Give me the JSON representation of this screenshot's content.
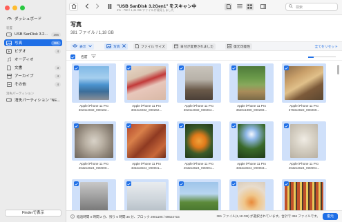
{
  "sidebar": {
    "items": [
      {
        "label": "ダッシュボード",
        "icon": "dashboard-icon"
      },
      {
        "label": "USB  SanDisk 3.2...",
        "count": "396",
        "icon": "drive-icon"
      },
      {
        "label": "写真",
        "count": "381",
        "icon": "photo-icon"
      },
      {
        "label": "ビデオ",
        "count": "4",
        "icon": "video-icon"
      },
      {
        "label": "オーディオ",
        "icon": "audio-icon"
      },
      {
        "label": "文書",
        "count": "3",
        "icon": "document-icon"
      },
      {
        "label": "アーカイブ",
        "count": "4",
        "icon": "archive-icon"
      },
      {
        "label": "その他",
        "count": "4",
        "icon": "other-icon"
      },
      {
        "label": "消失パーティション \"NE...",
        "icon": "partition-icon"
      }
    ],
    "section_devices": "装置",
    "section_lost": "消失パーティション",
    "finder_button": "Finderで表示"
  },
  "toolbar": {
    "title": "\"USB  SanDisk 3.2Gen1\" をスキャン中",
    "subtitle": "4% - 760 / 1,41 GB ファイルが発見しました"
  },
  "search": {
    "placeholder": "検索"
  },
  "header": {
    "title": "写真",
    "summary": "381 ファイル / 1,18 GB"
  },
  "filters": {
    "show": "表示",
    "photo": "写真",
    "file_size": "ファイル サイズ",
    "date_changed": "日付が変更されました",
    "recoverability": "復元可能性",
    "reset": "全てをリセット"
  },
  "list_header": {
    "name": "名前"
  },
  "files": [
    {
      "model": "Apple iPhone 11 Pro",
      "name": "3024x4032_000182..."
    },
    {
      "model": "Apple iPhone 11 Pro",
      "name": "3024x4032_000262..."
    },
    {
      "model": "Apple iPhone 11 Pro",
      "name": "3024x4032_000264..."
    },
    {
      "model": "Apple iPhone 11 Pro",
      "name": "3520x1980_000269..."
    },
    {
      "model": "Apple iPhone 11 Pro",
      "name": "3763x2822_000269..."
    },
    {
      "model": "Apple iPhone 11 Pro",
      "name": "4032x3024_000000..."
    },
    {
      "model": "Apple iPhone 11 Pro",
      "name": "4032x3024_000001..."
    },
    {
      "model": "Apple iPhone 11 Pro",
      "name": "4032x3024_000001..."
    },
    {
      "model": "Apple iPhone 11 Pro",
      "name": "4032x3024_000003..."
    },
    {
      "model": "Apple iPhone 11 Pro",
      "name": "4032x3024_000004..."
    },
    {
      "model": "",
      "name": ""
    },
    {
      "model": "",
      "name": ""
    },
    {
      "model": "",
      "name": ""
    },
    {
      "model": "",
      "name": ""
    },
    {
      "model": "",
      "name": ""
    }
  ],
  "status": {
    "left": "経過時間 0 時間 2 分、残り 0 時間 36 分、ブロック 2901196 / 69624715",
    "right": "381 ファイル(1,18 GB) が選択されています。合計で 396 ファイルです。",
    "recover_button": "復元"
  },
  "colors": {
    "accent": "#1f6fe6",
    "selection": "#cfe0fa"
  }
}
